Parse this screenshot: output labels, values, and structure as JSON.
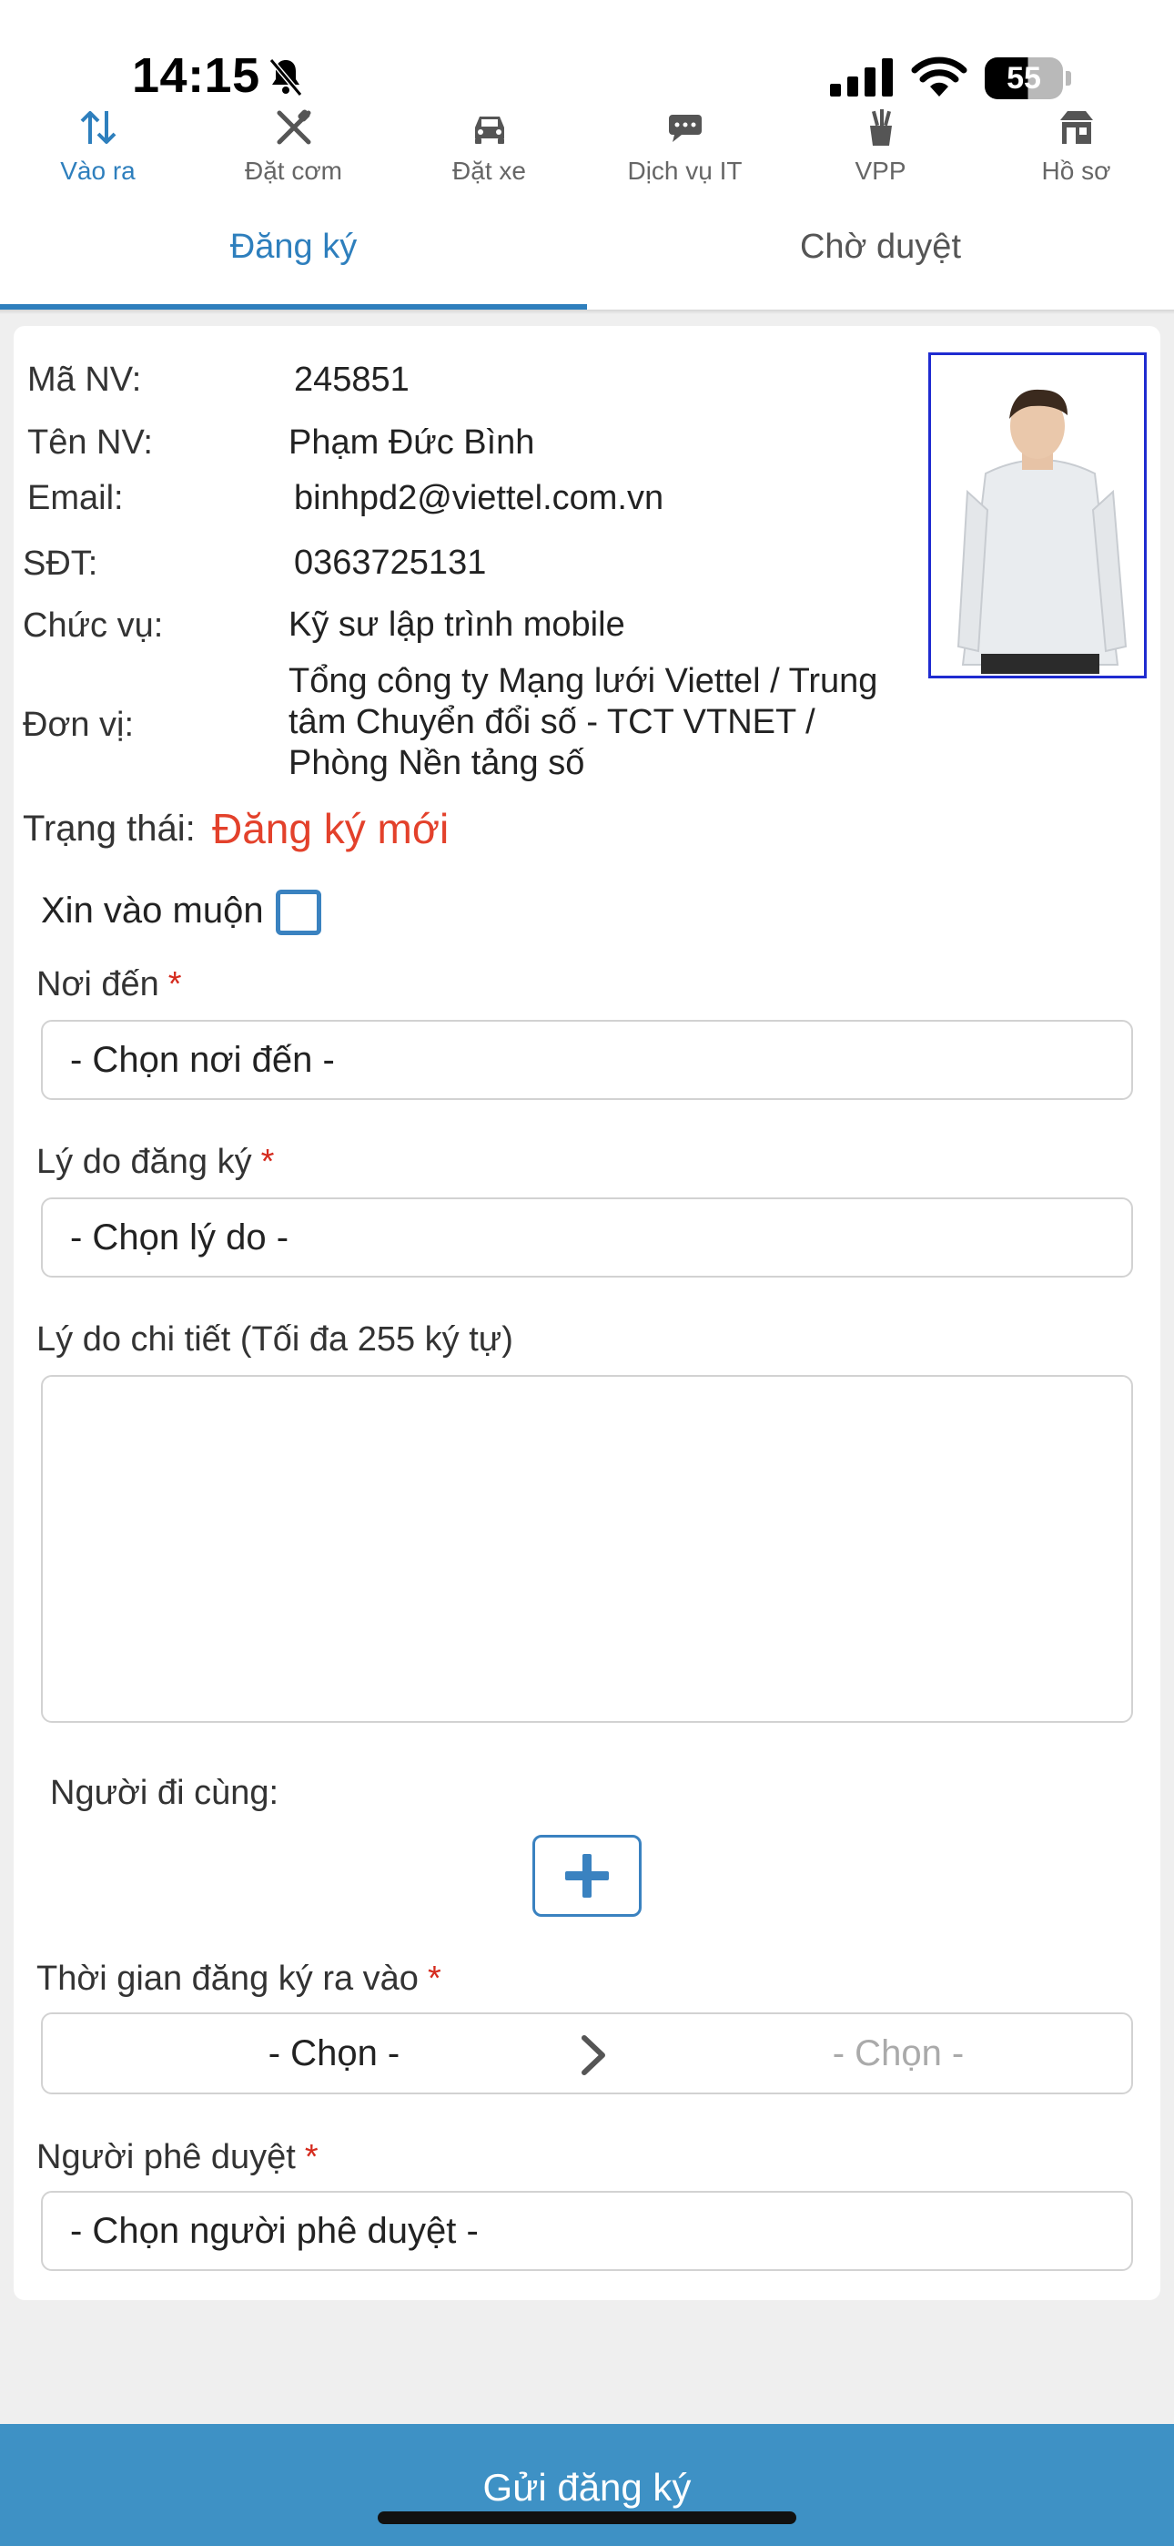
{
  "status_bar": {
    "time": "14:15",
    "battery": "55"
  },
  "nav": {
    "items": [
      {
        "label": "Vào ra",
        "icon": "arrows-up-down-icon",
        "active": true
      },
      {
        "label": "Đặt cơm",
        "icon": "utensils-icon"
      },
      {
        "label": "Đặt xe",
        "icon": "car-icon"
      },
      {
        "label": "Dịch vụ IT",
        "icon": "it-service-icon"
      },
      {
        "label": "VPP",
        "icon": "stationery-icon"
      },
      {
        "label": "Hồ sơ",
        "icon": "profile-shop-icon"
      }
    ]
  },
  "tabs": {
    "register": "Đăng ký",
    "pending": "Chờ duyệt"
  },
  "employee": {
    "id_label": "Mã NV:",
    "id": "245851",
    "name_label": "Tên NV:",
    "name": "Phạm Đức Bình",
    "email_label": "Email:",
    "email": "binhpd2@viettel.com.vn",
    "phone_label": "SĐT:",
    "phone": "0363725131",
    "position_label": "Chức vụ:",
    "position": "Kỹ sư lập trình mobile",
    "unit_label": "Đơn vị:",
    "unit_lines": [
      "Tổng công ty Mạng lưới Viettel / Trung",
      "tâm Chuyển đổi số - TCT VTNET /",
      "Phòng Nền tảng số"
    ]
  },
  "status": {
    "label": "Trạng thái:",
    "value": "Đăng ký mới"
  },
  "form": {
    "late_request": "Xin vào muộn",
    "destination_label": "Nơi đến",
    "destination_placeholder": "- Chọn nơi đến -",
    "reason_label": "Lý do đăng ký",
    "reason_placeholder": "- Chọn lý do -",
    "detail_label": "Lý do chi tiết (Tối đa 255 ký tự)",
    "companion_label": "Người đi cùng:",
    "time_label": "Thời gian đăng ký ra vào",
    "time_from": "- Chọn -",
    "time_to": "- Chọn -",
    "approver_label": "Người phê duyệt",
    "approver_placeholder": "- Chọn người phê duyệt -",
    "required_mark": "*"
  },
  "submit_label": "Gửi đăng ký",
  "colors": {
    "accent": "#2e7fbd",
    "status_red": "#e3412b",
    "submit_bg": "#3e91c5"
  }
}
